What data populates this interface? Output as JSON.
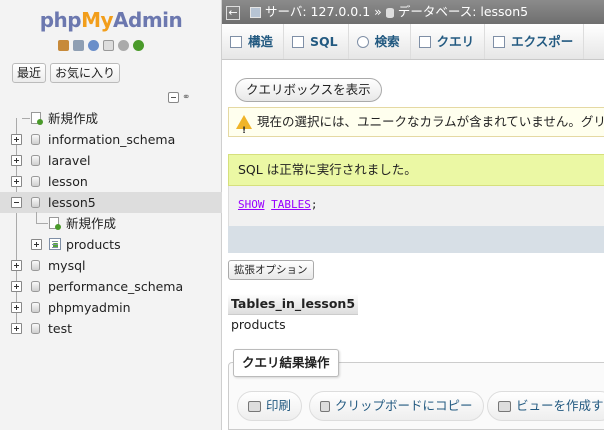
{
  "nav": {
    "logo": {
      "php": "php",
      "my": "My",
      "admin": "Admin"
    },
    "icons": [
      "home-icon",
      "database-icon",
      "help-icon",
      "docs-icon",
      "settings-icon",
      "reload-icon"
    ],
    "tabs": [
      "最近",
      "お気に入り"
    ],
    "tree": [
      {
        "label": "新規作成",
        "type": "new"
      },
      {
        "label": "information_schema",
        "type": "db"
      },
      {
        "label": "laravel",
        "type": "db"
      },
      {
        "label": "lesson",
        "type": "db"
      },
      {
        "label": "lesson5",
        "type": "db",
        "expanded": true,
        "selected": true
      },
      {
        "label": "新規作成",
        "type": "new-table"
      },
      {
        "label": "products",
        "type": "table"
      },
      {
        "label": "mysql",
        "type": "db"
      },
      {
        "label": "performance_schema",
        "type": "db"
      },
      {
        "label": "phpmyadmin",
        "type": "db"
      },
      {
        "label": "test",
        "type": "db"
      }
    ]
  },
  "breadcrumb": {
    "server_label": "サーバ: 127.0.0.1",
    "separator": "»",
    "db_label": "データベース: lesson5"
  },
  "topmenu": [
    {
      "label": "構造",
      "icon": "structure-icon"
    },
    {
      "label": "SQL",
      "icon": "sql-icon"
    },
    {
      "label": "検索",
      "icon": "search-icon"
    },
    {
      "label": "クエリ",
      "icon": "query-icon"
    },
    {
      "label": "エクスポー",
      "icon": "export-icon"
    }
  ],
  "querybox_button": "クエリボックスを表示",
  "notice": "現在の選択には、ユニークなカラムが含まれていません。グリッ",
  "success": "SQL は正常に実行されました。",
  "sql": {
    "kw1": "SHOW",
    "kw2": "TABLES",
    "end": ";"
  },
  "extended_options": "拡張オプション",
  "result": {
    "header": "Tables_in_lesson5",
    "rows": [
      "products"
    ]
  },
  "ops": {
    "legend": "クエリ結果操作",
    "buttons": [
      {
        "label": "印刷",
        "icon": "print-icon"
      },
      {
        "label": "クリップボードにコピー",
        "icon": "copy-icon"
      },
      {
        "label": "ビューを作成す",
        "icon": "view-icon"
      }
    ]
  },
  "colors": {
    "brand_php": "#6c78af",
    "brand_my": "#f29e1b",
    "success_bg": "#ebf8a4",
    "notice_bg": "#ffffee",
    "link": "#235a81"
  }
}
